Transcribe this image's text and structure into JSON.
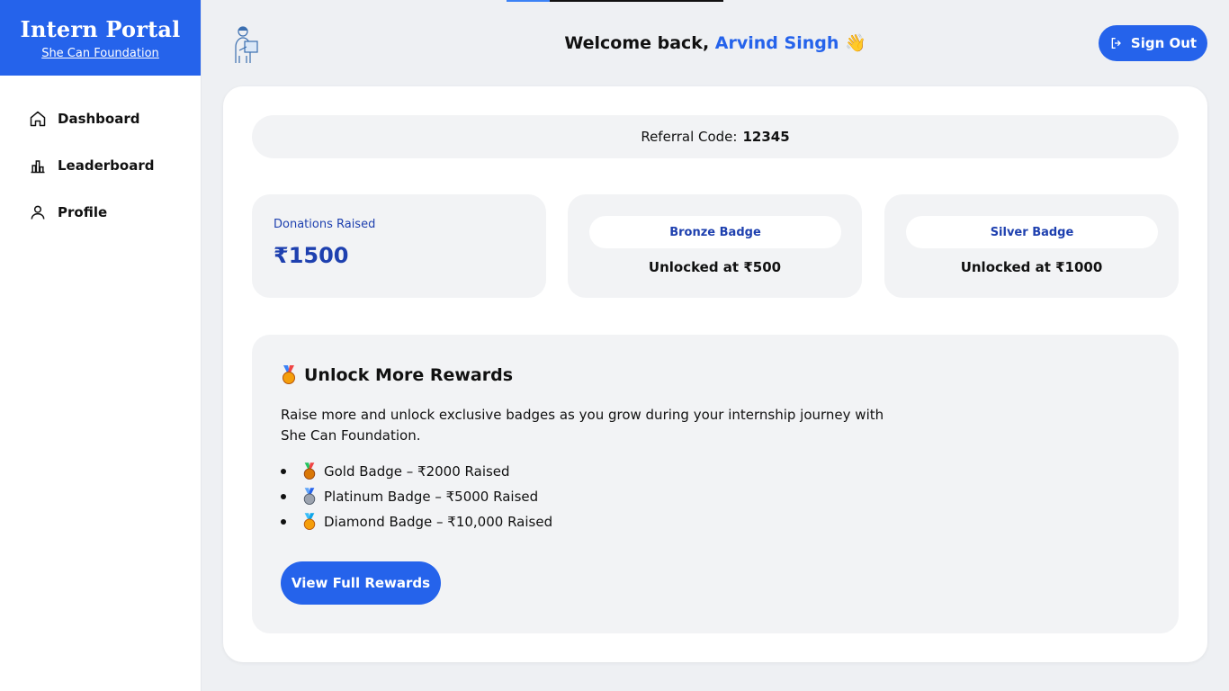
{
  "brand": {
    "title": "Intern Portal",
    "subtitle": "She Can Foundation"
  },
  "nav": {
    "items": [
      {
        "label": "Dashboard",
        "icon": "home-icon"
      },
      {
        "label": "Leaderboard",
        "icon": "bar-chart-icon"
      },
      {
        "label": "Profile",
        "icon": "user-icon"
      }
    ]
  },
  "header": {
    "welcome_prefix": "Welcome back,",
    "user_name": "Arvind Singh",
    "wave_emoji": "👋",
    "sign_out_label": "Sign Out"
  },
  "referral": {
    "label": "Referral Code:",
    "code": "12345"
  },
  "stats": {
    "donations_label": "Donations Raised",
    "donations_value": "₹1500",
    "bronze": {
      "name": "Bronze Badge",
      "unlock": "Unlocked at ₹500"
    },
    "silver": {
      "name": "Silver Badge",
      "unlock": "Unlocked at ₹1000"
    }
  },
  "rewards": {
    "title": "Unlock More Rewards",
    "description": "Raise more and unlock exclusive badges as you grow during your internship journey with She Can Foundation.",
    "items": [
      {
        "label": "Gold Badge – ₹2000 Raised",
        "color": "#d97706"
      },
      {
        "label": "Platinum Badge – ₹5000 Raised",
        "color": "#9ca3af"
      },
      {
        "label": "Diamond Badge – ₹10,000 Raised",
        "color": "#38bdf8"
      }
    ],
    "button_label": "View Full Rewards"
  },
  "colors": {
    "primary": "#2563eb",
    "primary_dark": "#1e40af",
    "panel": "#f2f3f5"
  }
}
